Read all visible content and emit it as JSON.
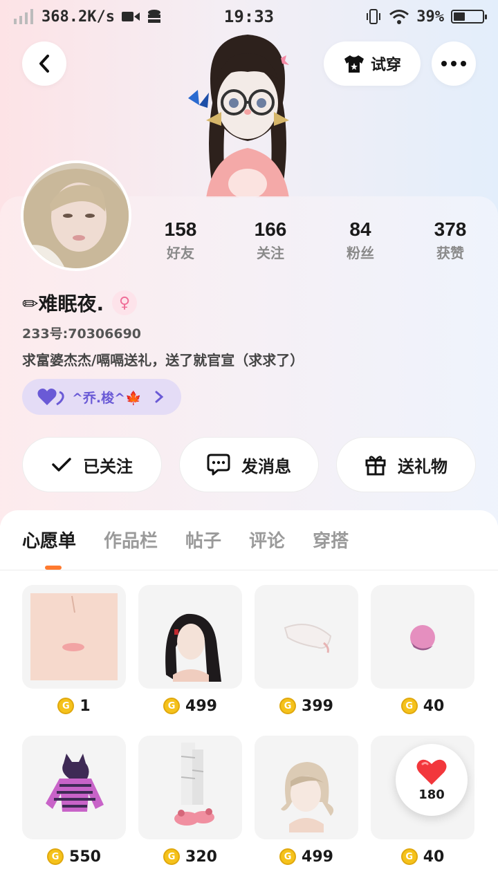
{
  "status_bar": {
    "net_speed": "368.2K/s",
    "time": "19:33",
    "battery": "39%",
    "battery_level": 0.39
  },
  "header": {
    "try_on_label": "试穿"
  },
  "profile": {
    "stats": [
      {
        "value": "158",
        "label": "好友"
      },
      {
        "value": "166",
        "label": "关注"
      },
      {
        "value": "84",
        "label": "粉丝"
      },
      {
        "value": "378",
        "label": "获赞"
      }
    ],
    "nickname": "✏难眠夜.",
    "gender_icon": "female-icon",
    "uid": "233号:70306690",
    "bio": "求富婆杰杰/嗝嗝送礼，送了就官宣（求求了）",
    "relation_tag": "^乔.梭^🍁"
  },
  "actions": {
    "follow": "已关注",
    "message": "发消息",
    "gift": "送礼物"
  },
  "tabs": [
    "心愿单",
    "作品栏",
    "帖子",
    "评论",
    "穿搭"
  ],
  "wishlist": [
    {
      "price": "1",
      "icon": "face-makeup"
    },
    {
      "price": "499",
      "icon": "black-hair"
    },
    {
      "price": "399",
      "icon": "white-feather"
    },
    {
      "price": "40",
      "icon": "pink-ball"
    },
    {
      "price": "550",
      "icon": "striped-hoodie"
    },
    {
      "price": "320",
      "icon": "pink-slippers"
    },
    {
      "price": "499",
      "icon": "blonde-hair"
    },
    {
      "price": "40",
      "icon": "heart"
    }
  ],
  "like_float": {
    "count": "180"
  },
  "colors": {
    "accent": "#ff7a2f",
    "coin": "#f5c21b",
    "tag_bg": "#e4dcf6",
    "tag_text": "#6a5ad6"
  }
}
